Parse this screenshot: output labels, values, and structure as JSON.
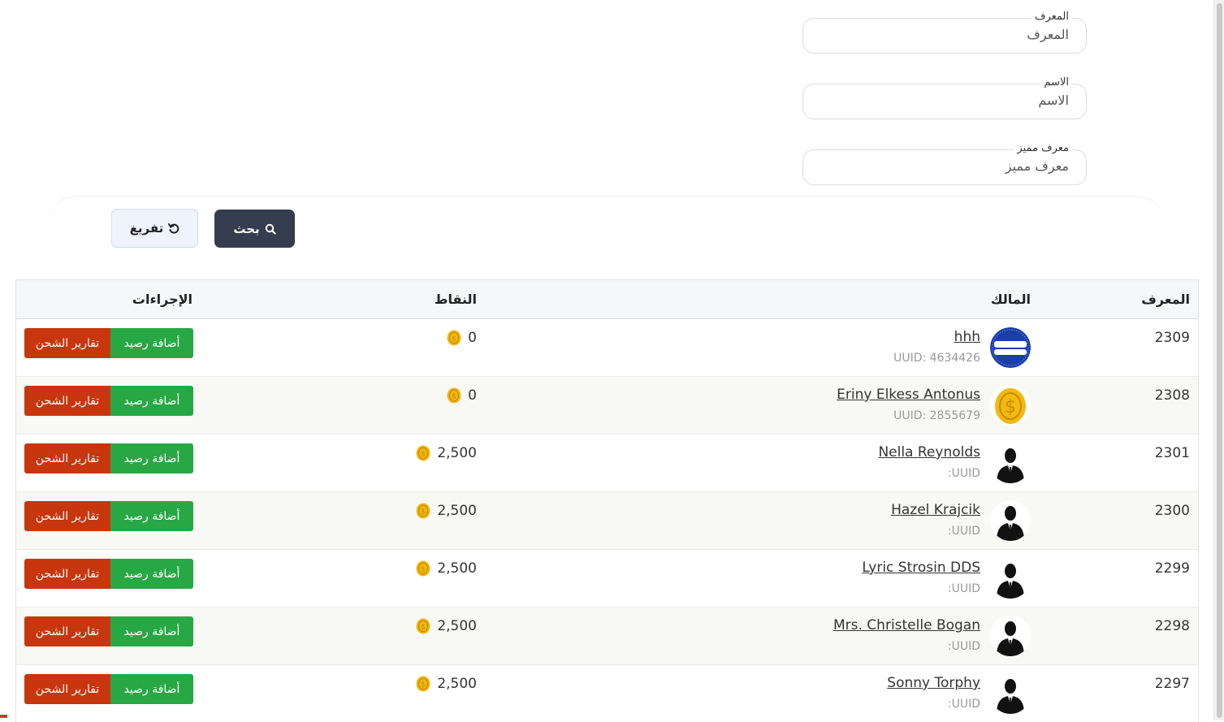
{
  "filters": [
    {
      "label": "المعرف",
      "placeholder": "المعرف",
      "value": ""
    },
    {
      "label": "الاسم",
      "placeholder": "الاسم",
      "value": ""
    },
    {
      "label": "معرف مميز",
      "placeholder": "معرف مميز",
      "value": ""
    }
  ],
  "actions": {
    "search_label": "بحث",
    "search_icon": "search-icon",
    "reset_label": "تفريغ",
    "reset_icon": "refresh-icon"
  },
  "table": {
    "headers": {
      "id": "المعرف",
      "owner": "المالك",
      "points": "النقاط",
      "actions": "الإجراءات"
    },
    "rows": [
      {
        "id": "2309",
        "name": "hhh",
        "uuid": "UUID: 4634426",
        "points": "0",
        "avatar": "blue-card-avatar",
        "add": "أضافة رصيد",
        "reports": "تقارير الشحن"
      },
      {
        "id": "2308",
        "name": "Eriny Elkess Antonus",
        "uuid": "UUID: 2855679",
        "points": "0",
        "avatar": "gold-coin-avatar",
        "add": "أضافة رصيد",
        "reports": "تقارير الشحن"
      },
      {
        "id": "2301",
        "name": "Nella Reynolds",
        "uuid": "UUID:",
        "points": "2,500",
        "avatar": "person-silhouette-avatar",
        "add": "أضافة رصيد",
        "reports": "تقارير الشحن"
      },
      {
        "id": "2300",
        "name": "Hazel Krajcik",
        "uuid": "UUID:",
        "points": "2,500",
        "avatar": "person-silhouette-avatar",
        "add": "أضافة رصيد",
        "reports": "تقارير الشحن"
      },
      {
        "id": "2299",
        "name": "Lyric Strosin DDS",
        "uuid": "UUID:",
        "points": "2,500",
        "avatar": "person-silhouette-avatar",
        "add": "أضافة رصيد",
        "reports": "تقارير الشحن"
      },
      {
        "id": "2298",
        "name": "Mrs. Christelle Bogan",
        "uuid": "UUID:",
        "points": "2,500",
        "avatar": "person-silhouette-avatar",
        "add": "أضافة رصيد",
        "reports": "تقارير الشحن"
      },
      {
        "id": "2297",
        "name": "Sonny Torphy",
        "uuid": "UUID:",
        "points": "2,500",
        "avatar": "person-silhouette-avatar",
        "add": "أضافة رصيد",
        "reports": "تقارير الشحن"
      }
    ]
  },
  "colors": {
    "search_button": "#353d4e",
    "reset_button": "#eef3fd",
    "add_balance_button": "#28a745",
    "reports_button": "#c8360e",
    "coin": "#f2b90f"
  }
}
